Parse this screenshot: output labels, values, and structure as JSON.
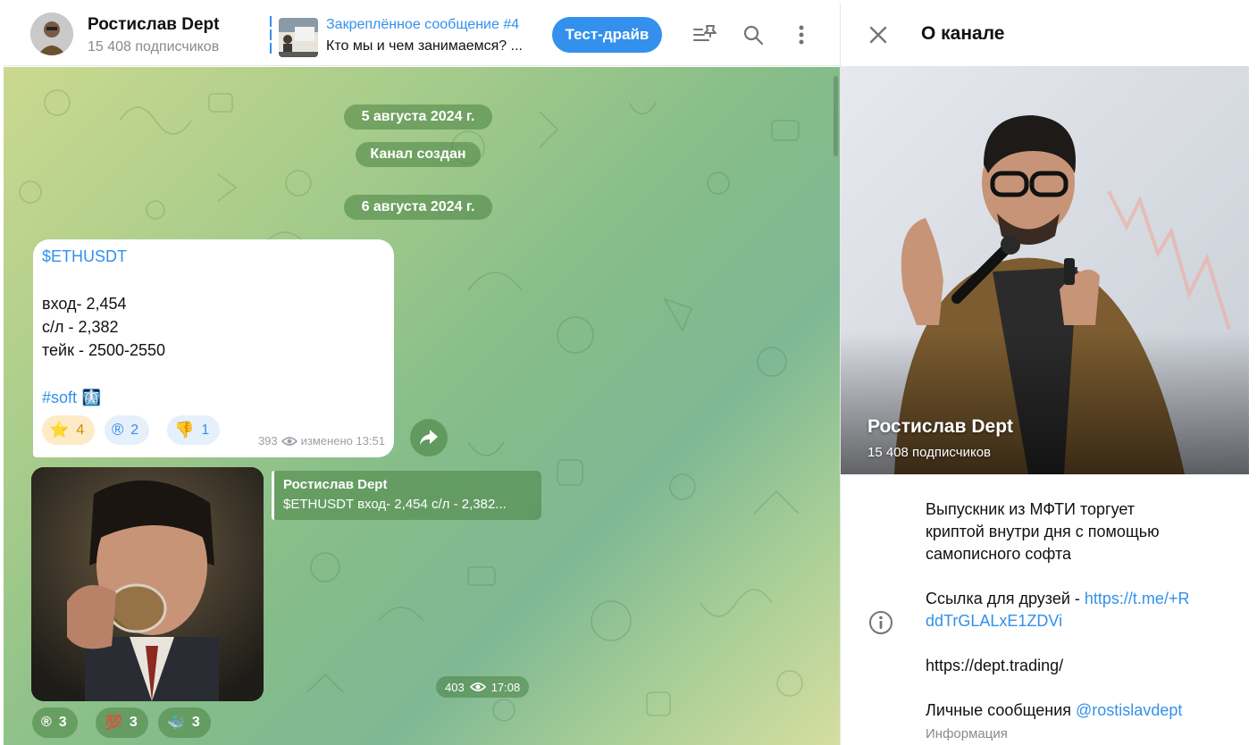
{
  "header": {
    "channel_name": "Ростислав Dept",
    "subscribers": "15 408 подписчиков",
    "pinned_title": "Закреплённое сообщение #4",
    "pinned_text": "Кто мы и чем занимаемся? ...",
    "test_drive_label": "Тест-драйв",
    "icons": [
      "filter-pins-icon",
      "search-icon",
      "more-vertical-icon"
    ]
  },
  "chat": {
    "date1": "5 августа 2024 г.",
    "service1": "Канал создан",
    "date2": "6 августа 2024 г.",
    "message1": {
      "ticker": "$ETHUSDT",
      "line_entry": "вход- 2,454",
      "line_sl": "с/л - 2,382",
      "line_tp": "тейк - 2500-2550",
      "hashtag": "#soft",
      "hashtag_emoji": "🩻",
      "reactions": [
        {
          "emoji": "⭐",
          "count": "4"
        },
        {
          "emoji": "®",
          "count": "2"
        },
        {
          "emoji": "👎",
          "count": "1"
        }
      ],
      "views": "393",
      "edited": "изменено 13:51"
    },
    "message2": {
      "reply_author": "Ростислав Dept",
      "reply_text": "$ETHUSDT вход- 2,454 с/л - 2,382...",
      "views": "403",
      "time": "17:08",
      "reactions": [
        {
          "emoji": "®",
          "count": "3"
        },
        {
          "emoji": "💯",
          "count": "3"
        },
        {
          "emoji": "🐳",
          "count": "3"
        }
      ]
    }
  },
  "info": {
    "title": "О канале",
    "name": "Ростислав Dept",
    "subscribers": "15 408 подписчиков",
    "desc_line1": "Выпускник из МФТИ торгует",
    "desc_line2": "криптой внутри дня с помощью",
    "desc_line3": "самописного софта",
    "friends_label": "Ссылка для друзей - ",
    "friends_link_1": "https://t.me/+R",
    "friends_link_2": "ddTrGLALxE1ZDVi",
    "site_link": "https://dept.trading/",
    "dm_label": "Личные сообщения ",
    "dm_handle": "@rostislavdept",
    "info_caption": "Информация"
  },
  "colors": {
    "accent": "#3390ec",
    "pill_green": "#488242",
    "reaction_bg": "#e6f0fb"
  }
}
